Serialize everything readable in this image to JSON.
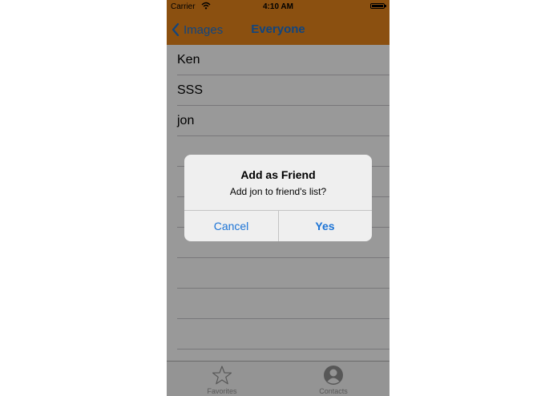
{
  "status_bar": {
    "carrier": "Carrier",
    "time": "4:10 AM",
    "battery_level": 1.0
  },
  "nav_bar": {
    "back_label": "Images",
    "title": "Everyone",
    "color": "#e8861c",
    "tint": "#1b73d6"
  },
  "list": {
    "items": [
      "Ken",
      "SSS",
      "jon"
    ]
  },
  "tab_bar": {
    "tabs": [
      {
        "label": "Favorites",
        "icon": "star-icon"
      },
      {
        "label": "Contacts",
        "icon": "contacts-icon"
      }
    ]
  },
  "alert": {
    "title": "Add as Friend",
    "message": "Add jon to friend's list?",
    "cancel_label": "Cancel",
    "confirm_label": "Yes"
  }
}
